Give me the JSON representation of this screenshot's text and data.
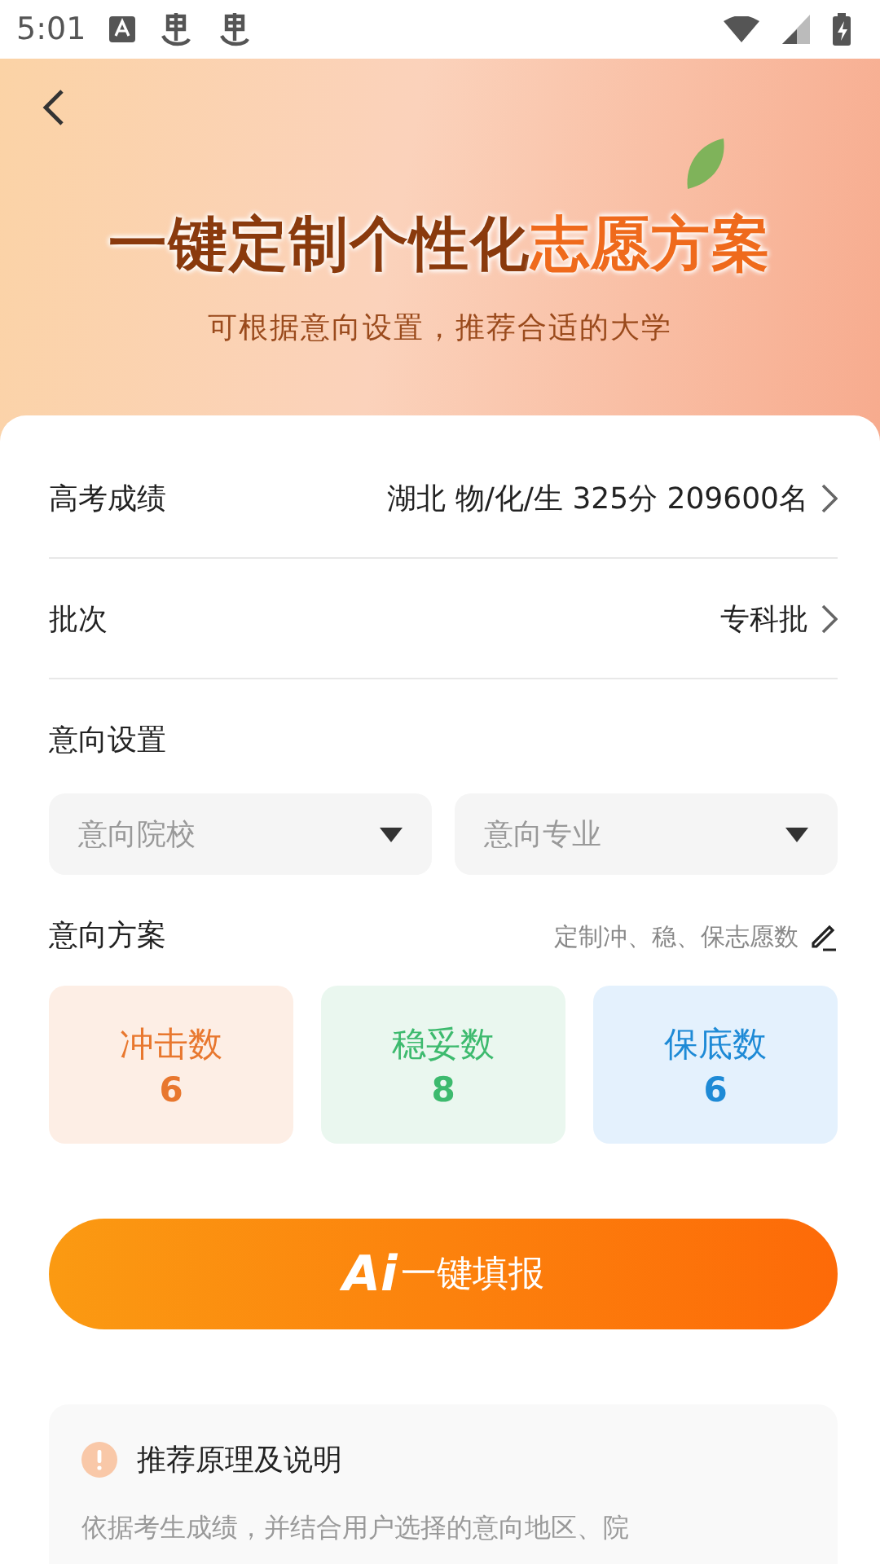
{
  "status_bar": {
    "time": "5:01"
  },
  "header": {
    "headline": [
      {
        "text": "一键定制个性化",
        "accent": false
      },
      {
        "text": "志愿方案",
        "accent": true
      }
    ],
    "subtitle": "可根据意向设置，推荐合适的大学"
  },
  "rows": [
    {
      "label": "高考成绩",
      "value": "湖北 物/化/生 325分 209600名"
    },
    {
      "label": "批次",
      "value": "专科批"
    }
  ],
  "intent_settings": {
    "title": "意向设置",
    "dropdowns": [
      {
        "placeholder": "意向院校"
      },
      {
        "placeholder": "意向专业"
      }
    ]
  },
  "intent_plan": {
    "title": "意向方案",
    "edit_link": "定制冲、稳、保志愿数",
    "cards": [
      {
        "kind": "rush",
        "label": "冲击数",
        "count": "6",
        "color": "#e8772e"
      },
      {
        "kind": "stable",
        "label": "稳妥数",
        "count": "8",
        "color": "#3dba6e"
      },
      {
        "kind": "safe",
        "label": "保底数",
        "count": "6",
        "color": "#1e8ad6"
      }
    ]
  },
  "fill_button": {
    "logo": "Ai",
    "label": "一键填报"
  },
  "info": {
    "title": "推荐原理及说明",
    "body": "依据考生成绩，并结合用户选择的意向地区、院"
  }
}
